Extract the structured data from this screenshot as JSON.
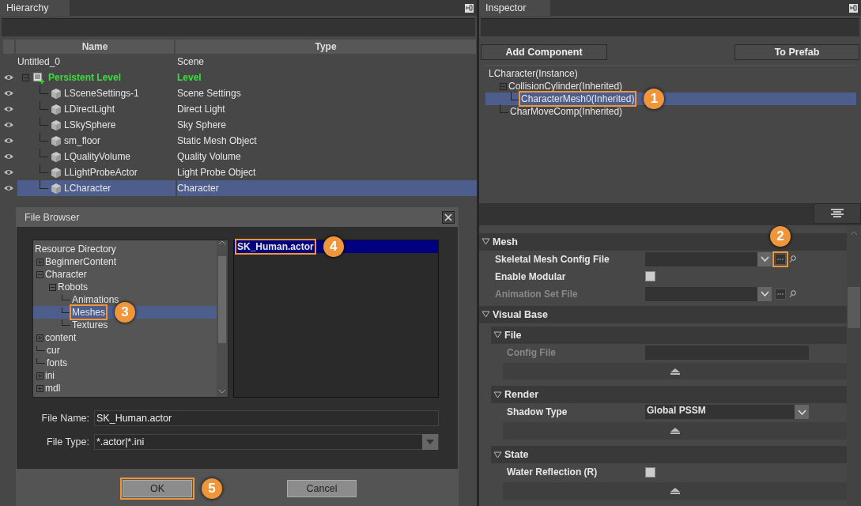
{
  "hierarchy": {
    "title": "Hierarchy",
    "columns": [
      "Name",
      "Type"
    ],
    "tree": {
      "name": "Untitled_0",
      "type": "Scene",
      "kind": "scene",
      "selected": false,
      "children": [
        {
          "name": "Persistent Level",
          "type": "Level",
          "kind": "level",
          "selected": false,
          "expanded": true,
          "children": [
            {
              "name": "LSceneSettings-1",
              "type": "Scene Settings",
              "kind": "object",
              "selected": false
            },
            {
              "name": "LDirectLight",
              "type": "Direct Light",
              "kind": "object",
              "selected": false
            },
            {
              "name": "LSkySphere",
              "type": "Sky Sphere",
              "kind": "object",
              "selected": false
            },
            {
              "name": "sm_floor",
              "type": "Static Mesh Object",
              "kind": "object",
              "selected": false
            },
            {
              "name": "LQualityVolume",
              "type": "Quality Volume",
              "kind": "object",
              "selected": false
            },
            {
              "name": "LLightProbeActor",
              "type": "Light Probe Object",
              "kind": "object",
              "selected": false
            },
            {
              "name": "LCharacter",
              "type": "Character",
              "kind": "object",
              "selected": true
            }
          ]
        }
      ]
    }
  },
  "file_browser": {
    "title": "File Browser",
    "tree": {
      "label": "Resource Directory",
      "selected": false,
      "children": [
        {
          "label": "BeginnerContent",
          "expanded": false,
          "selected": false
        },
        {
          "label": "Character",
          "expanded": true,
          "selected": false,
          "children": [
            {
              "label": "Robots",
              "expanded": true,
              "selected": false,
              "children": [
                {
                  "label": "Animations",
                  "selected": false
                },
                {
                  "label": "Meshes",
                  "selected": true,
                  "callout": "3"
                },
                {
                  "label": "Textures",
                  "selected": false
                }
              ]
            }
          ]
        },
        {
          "label": "content",
          "expanded": false,
          "selected": false
        },
        {
          "label": "cur",
          "selected": false
        },
        {
          "label": "fonts",
          "selected": false
        },
        {
          "label": "ini",
          "expanded": false,
          "selected": false
        },
        {
          "label": "mdl",
          "expanded": false,
          "selected": false
        }
      ]
    },
    "files": [
      {
        "name": "SK_Human.actor",
        "selected": true,
        "callout": "4"
      }
    ],
    "file_name_label": "File Name:",
    "file_name": "SK_Human.actor",
    "file_type_label": "File Type:",
    "file_type": "*.actor|*.ini",
    "buttons": [
      {
        "label": "OK",
        "callout": "5"
      },
      {
        "label": "Cancel"
      }
    ]
  },
  "inspector": {
    "title": "Inspector",
    "buttons": [
      "Add Component",
      "To Prefab"
    ],
    "components": {
      "label": "LCharacter(Instance)",
      "selected": false,
      "children": [
        {
          "label": "CollisionCylinder(Inherited)",
          "expanded": true,
          "selected": false,
          "children": [
            {
              "label": "CharacterMesh0(Inherited)",
              "selected": true,
              "callout": "1"
            }
          ]
        },
        {
          "label": "CharMoveComp(Inherited)",
          "selected": false
        }
      ]
    },
    "sections": [
      {
        "title": "Mesh",
        "expanded": true,
        "rows": [
          {
            "label": "Skeletal Mesh Config File",
            "kind": "file",
            "disabled": false,
            "callout": "2"
          },
          {
            "label": "Enable Modular",
            "kind": "checkbox",
            "checked": false
          },
          {
            "label": "Animation Set File",
            "kind": "file",
            "disabled": true
          }
        ]
      },
      {
        "title": "Visual Base",
        "expanded": true,
        "groups": [
          {
            "title": "File",
            "expanded": true,
            "rows": [
              {
                "label": "Config File",
                "kind": "text",
                "disabled": true
              }
            ]
          },
          {
            "title": "Render",
            "expanded": true,
            "rows": [
              {
                "label": "Shadow Type",
                "kind": "dropdown",
                "value": "Global PSSM"
              }
            ]
          },
          {
            "title": "State",
            "expanded": true,
            "rows": [
              {
                "label": "Water Reflection (R)",
                "kind": "checkbox",
                "checked": false
              }
            ]
          }
        ]
      }
    ]
  }
}
